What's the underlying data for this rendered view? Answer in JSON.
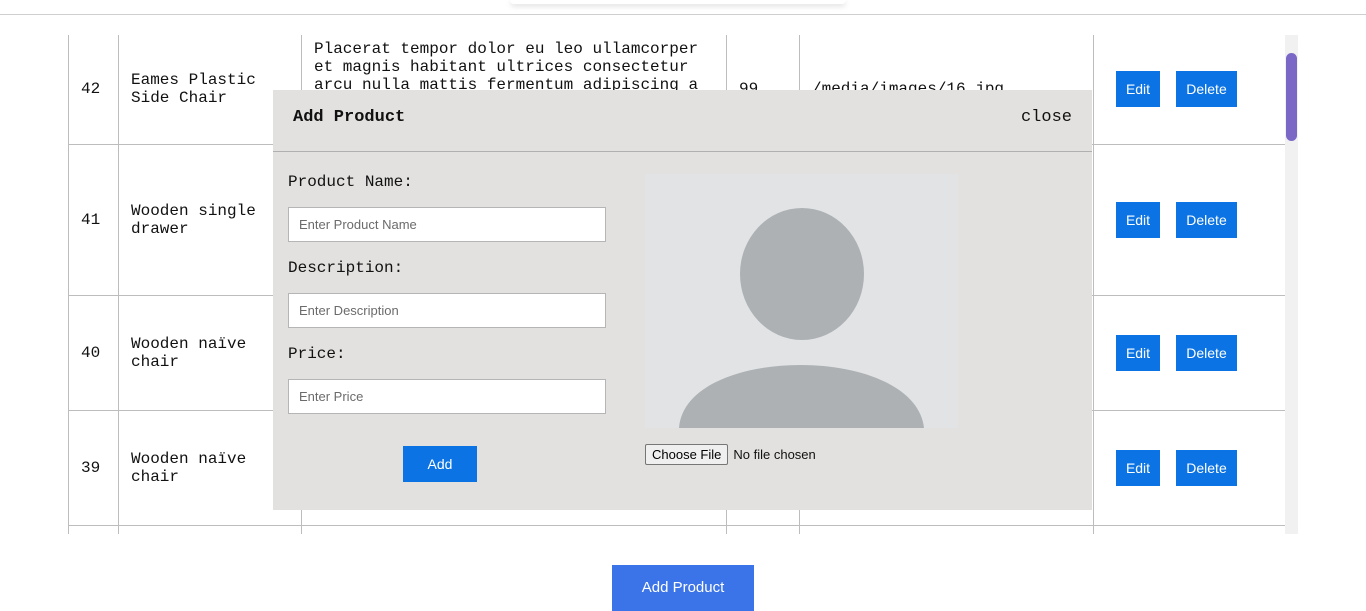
{
  "table": {
    "rows": [
      {
        "id": "42",
        "name": "Eames Plastic Side Chair",
        "description": "Placerat tempor dolor eu leo ullamcorper et magnis habitant ultrices consectetur arcu nulla mattis fermentum adipiscing a",
        "price": "99",
        "image": "/media/images/16.jpg",
        "edit": "Edit",
        "delete": "Delete"
      },
      {
        "id": "41",
        "name": "Wooden single drawer",
        "description": "",
        "price": "",
        "image": "",
        "edit": "Edit",
        "delete": "Delete"
      },
      {
        "id": "40",
        "name": "Wooden naïve chair",
        "description": "",
        "price": "",
        "image": "",
        "edit": "Edit",
        "delete": "Delete"
      },
      {
        "id": "39",
        "name": "Wooden naïve chair",
        "description": "",
        "price": "",
        "image": "",
        "edit": "Edit",
        "delete": "Delete"
      }
    ]
  },
  "modal": {
    "title": "Add Product",
    "close": "close",
    "product_name_label": "Product Name:",
    "product_name_placeholder": "Enter Product Name",
    "description_label": "Description:",
    "description_placeholder": "Enter Description",
    "price_label": "Price:",
    "price_placeholder": "Enter Price",
    "add_button": "Add",
    "image_placeholder_icon": "user-avatar-icon",
    "choose_file_button": "Choose File",
    "file_status": "No file chosen"
  },
  "footer": {
    "add_product_button": "Add Product"
  },
  "colors": {
    "primary": "#0b73e3",
    "modal_bg": "#e2e1df",
    "scroll_thumb": "#7b68c6"
  }
}
